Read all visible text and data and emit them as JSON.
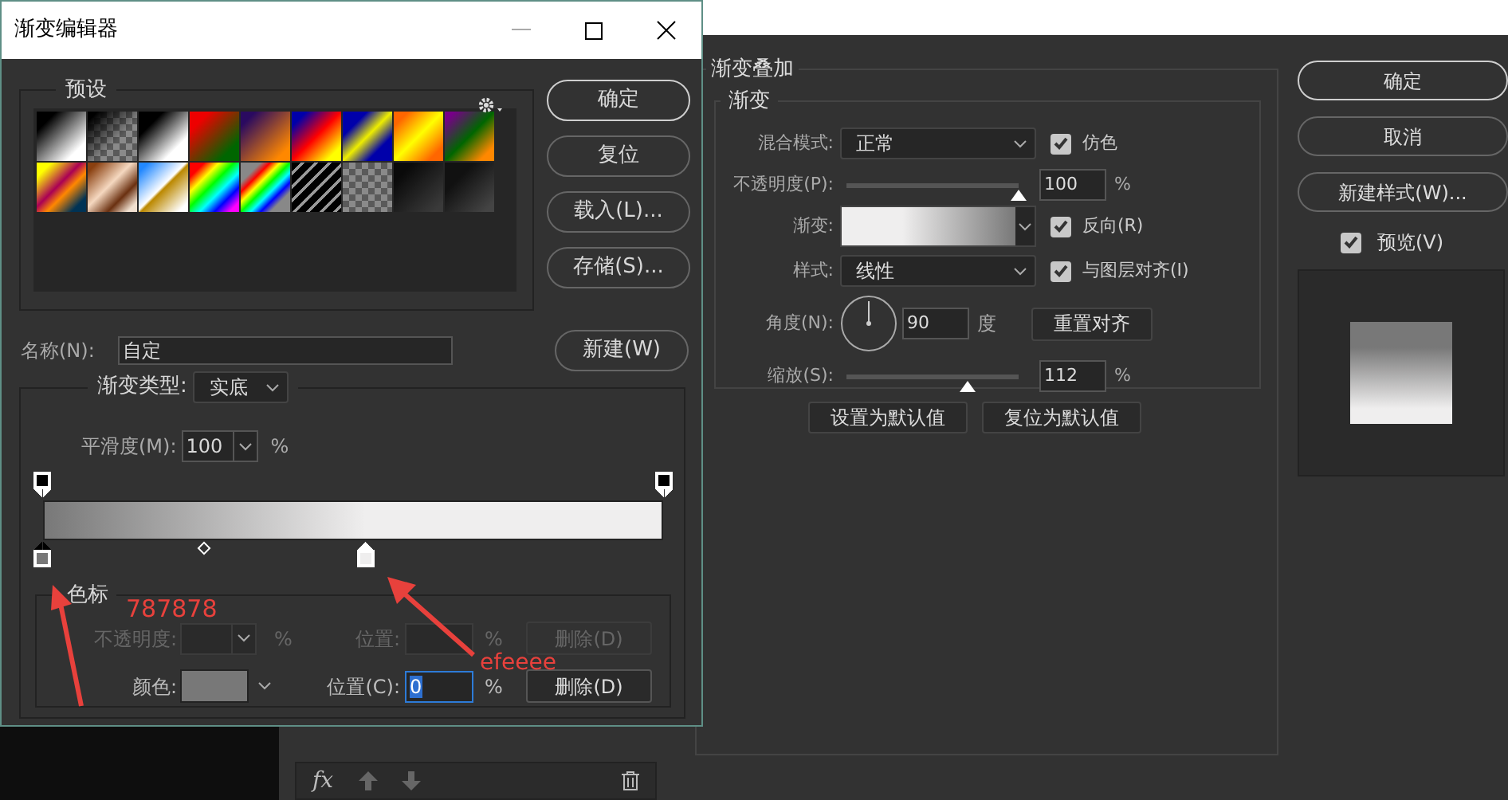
{
  "gradient_editor": {
    "title": "渐变编辑器",
    "presets_label": "预设",
    "buttons": [
      "确定",
      "复位",
      "载入(L)...",
      "存储(S)..."
    ],
    "name_label": "名称(N):",
    "name_value": "自定",
    "new_button": "新建(W)",
    "type_label": "渐变类型:",
    "type_value": "实底",
    "smoothness_label": "平滑度(M):",
    "smoothness_value": "100",
    "smoothness_unit": "%",
    "opacity_stops": [
      {
        "level": 0,
        "selected": false
      },
      {
        "level": 1,
        "selected": false
      }
    ],
    "midpoint": {
      "level": 0.26
    },
    "color_stops": [
      {
        "level": 0,
        "color": "#787878",
        "selected": true
      },
      {
        "level": 0.52,
        "color": "#efeeee",
        "selected": false
      }
    ],
    "stops_group": {
      "title": "色标",
      "rows": [
        {
          "kind": "opacity",
          "label": "不透明度:",
          "unit": "%",
          "position_label": "位置:",
          "position_value": "",
          "position_unit": "%",
          "delete": "删除(D)",
          "disabled": true
        },
        {
          "kind": "color",
          "label": "颜色:",
          "color": "#787878",
          "position_label": "位置(C):",
          "position_value": "0",
          "position_unit": "%",
          "delete": "删除(D)",
          "disabled": false
        }
      ]
    },
    "annotations": [
      {
        "text": "787878"
      },
      {
        "text": "efeeee"
      }
    ]
  },
  "layer_style": {
    "section": "渐变叠加",
    "group": "渐变",
    "blend_label": "混合模式:",
    "blend_value": "正常",
    "checks": [
      {
        "label": "仿色",
        "checked": true
      },
      {
        "label": "反向(R)",
        "checked": true
      },
      {
        "label": "与图层对齐(I)",
        "checked": true
      }
    ],
    "opacity_label": "不透明度(P):",
    "opacity": {
      "level": 1
    },
    "opacity_value": "100",
    "opacity_unit": "%",
    "gradient_label": "渐变:",
    "style_label": "样式:",
    "style_value": "线性",
    "angle_label": "角度(N):",
    "angle_value": "90",
    "angle_unit": "度",
    "reset_align": "重置对齐",
    "scale_label": "缩放(S):",
    "scale": {
      "level": 0.7
    },
    "scale_value": "112",
    "scale_unit": "%",
    "fx_label": "fx",
    "bottom_buttons": [
      "设置为默认值",
      "复位为默认值"
    ],
    "side_buttons": [
      "确定",
      "取消",
      "新建样式(W)..."
    ],
    "preview": {
      "label": "预览(V)",
      "checked": true
    }
  }
}
